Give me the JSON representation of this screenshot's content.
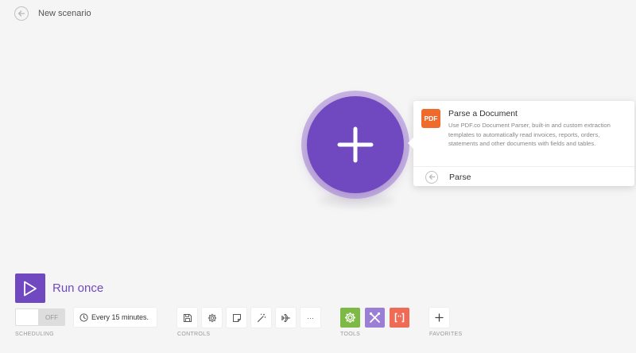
{
  "header": {
    "title": "New scenario"
  },
  "popover": {
    "result": {
      "badge": "PDF",
      "title": "Parse a Document",
      "description": "Use PDF.co Document Parser, built-in and custom extraction templates to automatically read invoices, reports, orders, statements and other documents with fields and tables."
    },
    "search": {
      "value": "Parse"
    }
  },
  "footer": {
    "run_label": "Run once",
    "scheduling": {
      "toggle_state": "OFF",
      "interval": "Every 15 minutes.",
      "label": "SCHEDULING"
    },
    "controls": {
      "label": "CONTROLS",
      "more": "···"
    },
    "tools": {
      "label": "TOOLS",
      "colors": [
        "#7cba45",
        "#9b7fd6",
        "#ef6b55"
      ]
    },
    "favorites": {
      "label": "FAVORITES"
    }
  },
  "colors": {
    "accent": "#7049c0",
    "pdf_brand": "#ef6b2b"
  }
}
